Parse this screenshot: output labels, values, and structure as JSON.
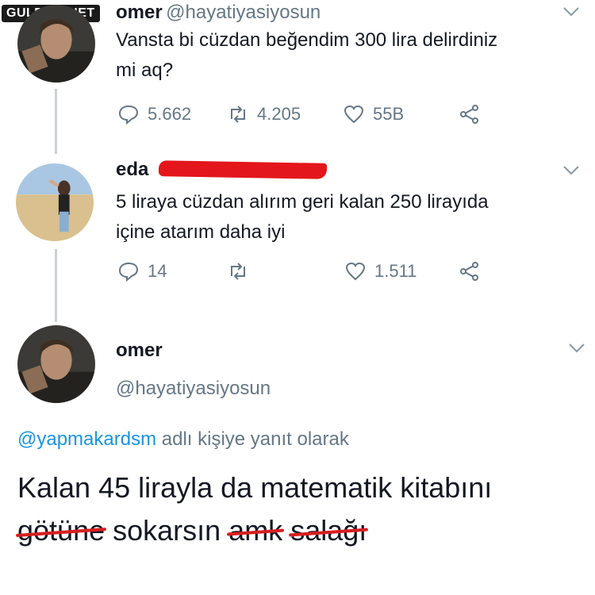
{
  "watermark": "GULDUM.NET",
  "tweets": [
    {
      "name": "omer",
      "handle": "@hayatiyasiyosun",
      "text_line1": "Vansta bi cüzdan beğendim 300 lira delirdiniz",
      "text_line2": "mi aq?",
      "replies": "5.662",
      "retweets": "4.205",
      "likes": "55B"
    },
    {
      "name": "eda",
      "text_line1": "5 liraya cüzdan alırım geri kalan 250 lirayıda",
      "text_line2": "içine atarım daha iyi",
      "replies": "14",
      "retweets": "",
      "likes": "1.511"
    },
    {
      "name": "omer",
      "handle": "@hayatiyasiyosun"
    }
  ],
  "reply_context": {
    "mention": "@yapmakardsm",
    "suffix": " adlı kişiye yanıt olarak"
  },
  "final_tweet": {
    "line1": "Kalan 45 lirayla da matematik kitabını",
    "w1": "götüne",
    "w2": " sokarsın ",
    "w3": "amk",
    "w4": " ",
    "w5": "salağı"
  },
  "colors": {
    "accent": "#1b95e0",
    "secondary_text": "#657786",
    "redaction": "#e3161b"
  },
  "icons": [
    "reply-icon",
    "retweet-icon",
    "like-icon",
    "share-icon",
    "chevron-down-icon"
  ]
}
